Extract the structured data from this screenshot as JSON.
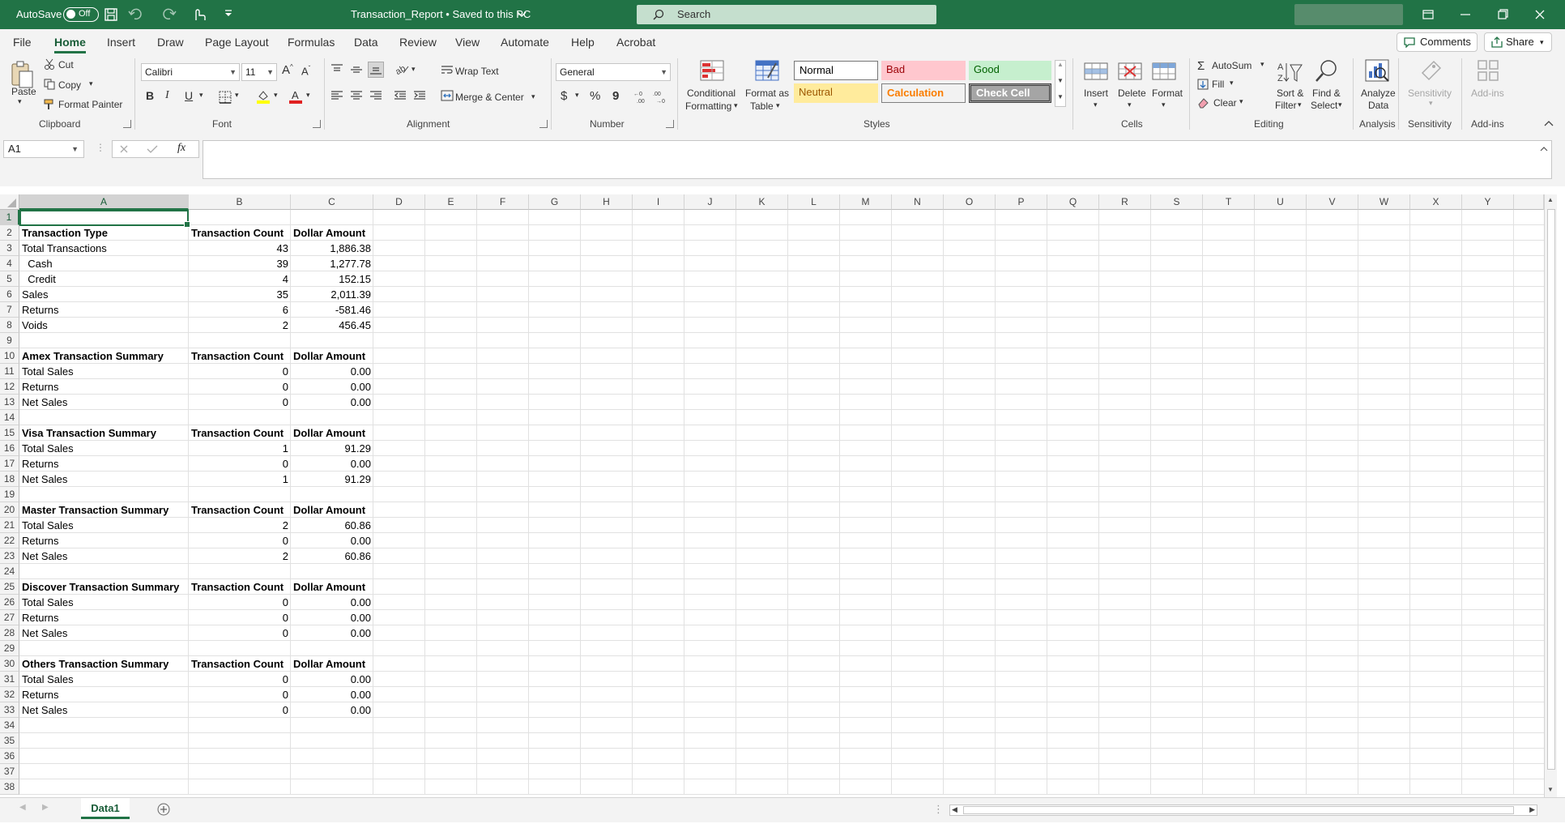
{
  "titlebar": {
    "autosave_label": "AutoSave",
    "autosave_state": "Off",
    "doc_title": "Transaction_Report • Saved to this PC",
    "search_placeholder": "Search"
  },
  "menu": {
    "tabs": [
      "File",
      "Home",
      "Insert",
      "Draw",
      "Page Layout",
      "Formulas",
      "Data",
      "Review",
      "View",
      "Automate",
      "Help",
      "Acrobat"
    ],
    "active": "Home",
    "comments_label": "Comments",
    "share_label": "Share"
  },
  "ribbon": {
    "clipboard": {
      "paste": "Paste",
      "cut": "Cut",
      "copy": "Copy",
      "format_painter": "Format Painter",
      "group": "Clipboard"
    },
    "font": {
      "name": "Calibri",
      "size": "11",
      "group": "Font",
      "bold": "B",
      "italic": "I",
      "underline": "U"
    },
    "alignment": {
      "wrap_text": "Wrap Text",
      "merge_center": "Merge & Center",
      "group": "Alignment"
    },
    "number": {
      "format": "General",
      "group": "Number",
      "currency": "$",
      "percent": "%",
      "comma": "9"
    },
    "styles": {
      "conditional_formatting_1": "Conditional",
      "conditional_formatting_2": "Formatting",
      "format_as_table_1": "Format as",
      "format_as_table_2": "Table",
      "normal": "Normal",
      "bad": "Bad",
      "good": "Good",
      "neutral": "Neutral",
      "calculation": "Calculation",
      "check_cell": "Check Cell",
      "group": "Styles"
    },
    "cells": {
      "insert": "Insert",
      "delete": "Delete",
      "format": "Format",
      "group": "Cells"
    },
    "editing": {
      "autosum": "AutoSum",
      "fill": "Fill",
      "clear": "Clear",
      "sort_filter_1": "Sort &",
      "sort_filter_2": "Filter",
      "find_select_1": "Find &",
      "find_select_2": "Select",
      "group": "Editing"
    },
    "analysis": {
      "analyze_1": "Analyze",
      "analyze_2": "Data",
      "group": "Analysis"
    },
    "sensitivity": {
      "label": "Sensitivity",
      "group": "Sensitivity"
    },
    "addins": {
      "label": "Add-ins",
      "group": "Add-ins"
    }
  },
  "formula_bar": {
    "name_box": "A1",
    "fx": "fx",
    "formula": ""
  },
  "columns": [
    "A",
    "B",
    "C",
    "D",
    "E",
    "F",
    "G",
    "H",
    "I",
    "J",
    "K",
    "L",
    "M",
    "N",
    "O",
    "P",
    "Q",
    "R",
    "S",
    "T",
    "U",
    "V",
    "W",
    "X",
    "Y"
  ],
  "rows": [
    {
      "a": "",
      "b": "",
      "c": ""
    },
    {
      "a": "Transaction Type",
      "b": "Transaction Count",
      "c": "Dollar Amount",
      "header": true
    },
    {
      "a": "Total Transactions",
      "b": "43",
      "c": "1,886.38"
    },
    {
      "a": "  Cash",
      "b": "39",
      "c": "1,277.78"
    },
    {
      "a": "  Credit",
      "b": "4",
      "c": "152.15"
    },
    {
      "a": "Sales",
      "b": "35",
      "c": "2,011.39"
    },
    {
      "a": "Returns",
      "b": "6",
      "c": "-581.46"
    },
    {
      "a": "Voids",
      "b": "2",
      "c": "456.45"
    },
    {
      "a": "",
      "b": "",
      "c": ""
    },
    {
      "a": "Amex Transaction Summary",
      "b": "Transaction Count",
      "c": "Dollar Amount",
      "header": true
    },
    {
      "a": "Total Sales",
      "b": "0",
      "c": "0.00"
    },
    {
      "a": "Returns",
      "b": "0",
      "c": "0.00"
    },
    {
      "a": "Net Sales",
      "b": "0",
      "c": "0.00"
    },
    {
      "a": "",
      "b": "",
      "c": ""
    },
    {
      "a": "Visa Transaction Summary",
      "b": "Transaction Count",
      "c": "Dollar Amount",
      "header": true
    },
    {
      "a": "Total Sales",
      "b": "1",
      "c": "91.29"
    },
    {
      "a": "Returns",
      "b": "0",
      "c": "0.00"
    },
    {
      "a": "Net Sales",
      "b": "1",
      "c": "91.29"
    },
    {
      "a": "",
      "b": "",
      "c": ""
    },
    {
      "a": "Master Transaction Summary",
      "b": "Transaction Count",
      "c": "Dollar Amount",
      "header": true
    },
    {
      "a": "Total Sales",
      "b": "2",
      "c": "60.86"
    },
    {
      "a": "Returns",
      "b": "0",
      "c": "0.00"
    },
    {
      "a": "Net Sales",
      "b": "2",
      "c": "60.86"
    },
    {
      "a": "",
      "b": "",
      "c": ""
    },
    {
      "a": "Discover Transaction Summary",
      "b": "Transaction Count",
      "c": "Dollar Amount",
      "header": true
    },
    {
      "a": "Total Sales",
      "b": "0",
      "c": "0.00"
    },
    {
      "a": "Returns",
      "b": "0",
      "c": "0.00"
    },
    {
      "a": "Net Sales",
      "b": "0",
      "c": "0.00"
    },
    {
      "a": "",
      "b": "",
      "c": ""
    },
    {
      "a": "Others Transaction Summary",
      "b": "Transaction Count",
      "c": "Dollar Amount",
      "header": true
    },
    {
      "a": "Total Sales",
      "b": "0",
      "c": "0.00"
    },
    {
      "a": "Returns",
      "b": "0",
      "c": "0.00"
    },
    {
      "a": "Net Sales",
      "b": "0",
      "c": "0.00"
    },
    {
      "a": "",
      "b": "",
      "c": ""
    },
    {
      "a": "",
      "b": "",
      "c": ""
    },
    {
      "a": "",
      "b": "",
      "c": ""
    },
    {
      "a": "",
      "b": "",
      "c": ""
    },
    {
      "a": "",
      "b": "",
      "c": ""
    }
  ],
  "sheet_tabs": [
    "Data1"
  ],
  "colors": {
    "accent": "#217346",
    "bad_bg": "#ffc7ce",
    "bad_fg": "#9c0006",
    "good_bg": "#c6efce",
    "good_fg": "#006100",
    "neutral_bg": "#ffeb9c",
    "neutral_fg": "#9c5700",
    "calc_fg": "#fa7d00",
    "check_bg": "#a5a5a5"
  }
}
